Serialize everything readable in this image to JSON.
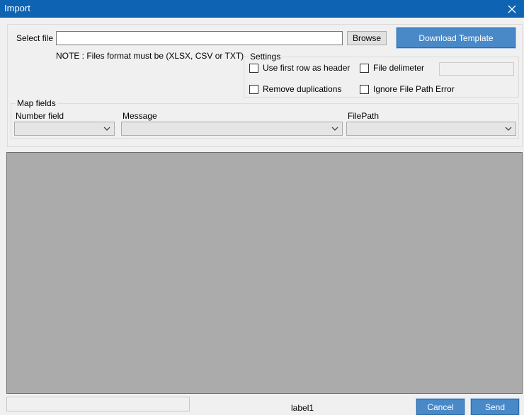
{
  "window": {
    "title": "Import",
    "close_icon": "close-icon"
  },
  "file": {
    "label": "Select file",
    "value": "",
    "browse_label": "Browse",
    "download_label": "Download Template",
    "note": "NOTE :  Files format must be (XLSX, CSV or TXT)"
  },
  "settings": {
    "title": "Settings",
    "use_first_row": {
      "label": "Use first row as header",
      "checked": false
    },
    "file_delimiter": {
      "label": "File delimeter",
      "checked": false,
      "value": ""
    },
    "remove_duplications": {
      "label": "Remove duplications",
      "checked": false
    },
    "ignore_path_error": {
      "label": "Ignore File Path Error",
      "checked": false
    }
  },
  "map_fields": {
    "title": "Map fields",
    "number_field": {
      "label": "Number field",
      "value": ""
    },
    "message": {
      "label": "Message",
      "value": ""
    },
    "file_path": {
      "label": "FilePath",
      "value": ""
    }
  },
  "footer": {
    "status_value": "",
    "label1": "label1",
    "cancel_label": "Cancel",
    "send_label": "Send"
  }
}
